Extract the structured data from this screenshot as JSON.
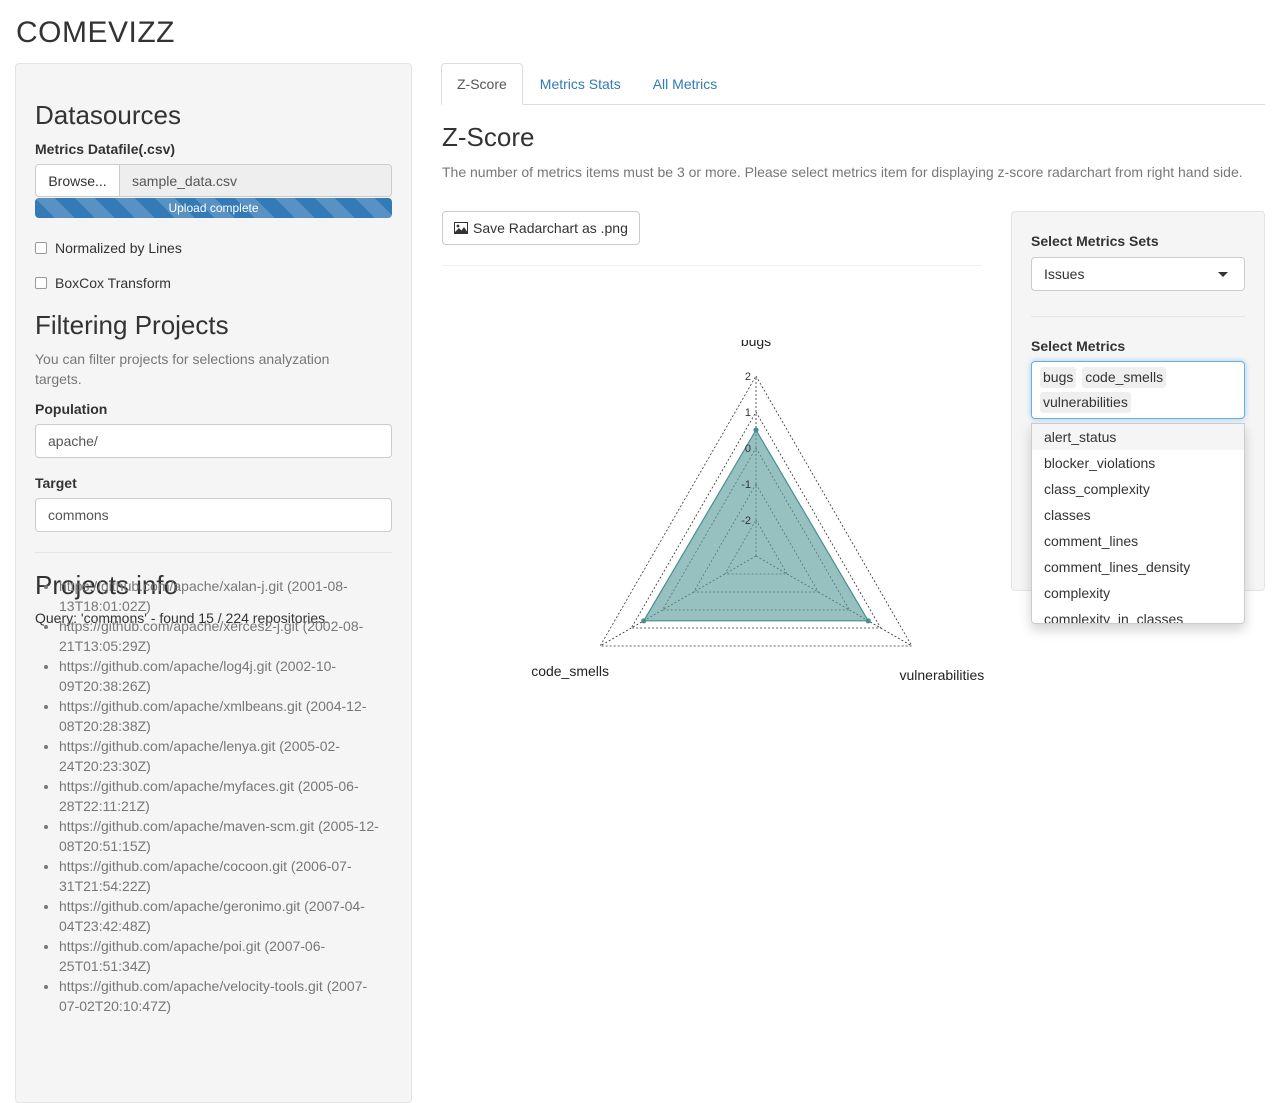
{
  "app_title": "COMEVIZZ",
  "sidebar": {
    "datasources_heading": "Datasources",
    "metrics_file_label": "Metrics Datafile(.csv)",
    "browse_label": "Browse...",
    "file_name": "sample_data.csv",
    "upload_status": "Upload complete",
    "upload_progress_percent": 100,
    "normalized_label": "Normalized by Lines",
    "boxcox_label": "BoxCox Transform",
    "filtering_heading": "Filtering Projects",
    "filtering_help": "You can filter projects for selections analyzation targets.",
    "population_label": "Population",
    "population_value": "apache/",
    "target_label": "Target",
    "target_value": "commons",
    "projects_info_heading": "Projects info",
    "query_text": "Query: 'commons' - found 15 / 224 repositories.",
    "repos": [
      "https://github.com/apache/xalan-j.git (2001-08-13T18:01:02Z)",
      "https://github.com/apache/xerces2-j.git (2002-08-21T13:05:29Z)",
      "https://github.com/apache/log4j.git (2002-10-09T20:38:26Z)",
      "https://github.com/apache/xmlbeans.git (2004-12-08T20:28:38Z)",
      "https://github.com/apache/lenya.git (2005-02-24T20:23:30Z)",
      "https://github.com/apache/myfaces.git (2005-06-28T22:11:21Z)",
      "https://github.com/apache/maven-scm.git (2005-12-08T20:51:15Z)",
      "https://github.com/apache/cocoon.git (2006-07-31T21:54:22Z)",
      "https://github.com/apache/geronimo.git (2007-04-04T23:42:48Z)",
      "https://github.com/apache/poi.git (2007-06-25T01:51:34Z)",
      "https://github.com/apache/velocity-tools.git (2007-07-02T20:10:47Z)"
    ]
  },
  "tabs": [
    {
      "label": "Z-Score",
      "active": true
    },
    {
      "label": "Metrics Stats",
      "active": false
    },
    {
      "label": "All Metrics",
      "active": false
    }
  ],
  "main": {
    "heading": "Z-Score",
    "description": "The number of metrics items must be 3 or more. Please select metrics item for displaying z-score radarchart from right hand side.",
    "save_button_label": "Save Radarchart as .png",
    "save_icon": "image-icon"
  },
  "right_panel": {
    "metrics_sets_label": "Select Metrics Sets",
    "metrics_sets_value": "Issues",
    "metrics_label": "Select Metrics",
    "selected_metrics": [
      "bugs",
      "code_smells",
      "vulnerabilities"
    ],
    "options": [
      "alert_status",
      "blocker_violations",
      "class_complexity",
      "classes",
      "comment_lines",
      "comment_lines_density",
      "complexity",
      "complexity_in_classes"
    ]
  },
  "chart_data": {
    "type": "radar",
    "axes": [
      "bugs",
      "vulnerabilities",
      "code_smells"
    ],
    "rlim": [
      -3,
      2
    ],
    "ticks": [
      2,
      1,
      0,
      -1,
      -2
    ],
    "values": [
      0.5,
      0.6,
      0.6
    ],
    "colors": {
      "fill": "#5f9ea0",
      "stroke": "#4a8f8c"
    }
  }
}
